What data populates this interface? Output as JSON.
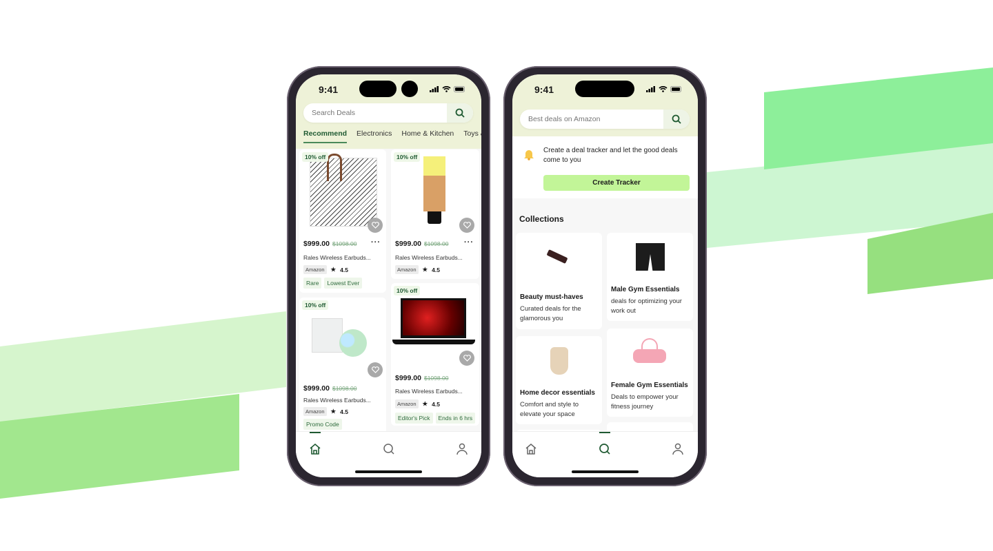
{
  "colors": {
    "accent": "#1f5a32",
    "header_bg": "#eef2d8",
    "tracker_button": "#c2f598",
    "bg_green_light": "#d4f5cc",
    "bg_green_dark": "#94e382"
  },
  "left_phone": {
    "status": {
      "time": "9:41"
    },
    "search": {
      "placeholder": "Search Deals",
      "icon": "search-icon"
    },
    "tabs": [
      "Recommend",
      "Electronics",
      "Home & Kitchen",
      "Toys &"
    ],
    "products": [
      {
        "badge": "10% off",
        "price": "$999.00",
        "old_price": "$1098.00",
        "title": "Rales Wireless Earbuds...",
        "store": "Amazon",
        "rating": "4.5",
        "tags": [
          "Rare",
          "Lowest Ever"
        ],
        "image": "chevron-pattern-tote-bag"
      },
      {
        "badge": "10% off",
        "price": "$999.00",
        "old_price": "$1098.00",
        "title": "Rales Wireless Earbuds...",
        "store": "Amazon",
        "rating": "4.5",
        "tags": [],
        "image": "foundation-tube"
      },
      {
        "badge": "10% off",
        "price": "$999.00",
        "old_price": "$1098.00",
        "title": "Rales Wireless Earbuds...",
        "store": "Amazon",
        "rating": "4.5",
        "tags": [
          "Promo Code"
        ],
        "image": "pet-ball-toy"
      },
      {
        "badge": "10% off",
        "price": "$999.00",
        "old_price": "$1098.00",
        "title": "Rales Wireless Earbuds...",
        "store": "Amazon",
        "rating": "4.5",
        "tags": [
          "Editor's Pick",
          "Ends in 6 hrs"
        ],
        "image": "gaming-laptop"
      }
    ],
    "nav": {
      "items": [
        "home-icon",
        "search-icon",
        "profile-icon"
      ],
      "active": "home"
    }
  },
  "right_phone": {
    "status": {
      "time": "9:41"
    },
    "search": {
      "placeholder": "Best deals on Amazon",
      "icon": "search-icon"
    },
    "tracker": {
      "text": "Create a deal tracker and let the good deals come to you",
      "button": "Create Tracker",
      "icon": "bell-icon"
    },
    "collections_title": "Collections",
    "collections": [
      {
        "title": "Beauty must-haves",
        "desc": "Curated deals for the glamorous you",
        "image": "lipstick"
      },
      {
        "title": "Male Gym Essentials",
        "desc": "deals for optimizing your work out",
        "image": "gym-shorts"
      },
      {
        "title": "Home decor essentials",
        "desc": "Comfort and style to elevate your space",
        "image": "vase"
      },
      {
        "title": "Female Gym Essentials",
        "desc": "Deals to empower your fitness journey",
        "image": "pink-duffel-bag"
      }
    ],
    "nav": {
      "items": [
        "home-icon",
        "search-icon",
        "profile-icon"
      ],
      "active": "search"
    }
  }
}
